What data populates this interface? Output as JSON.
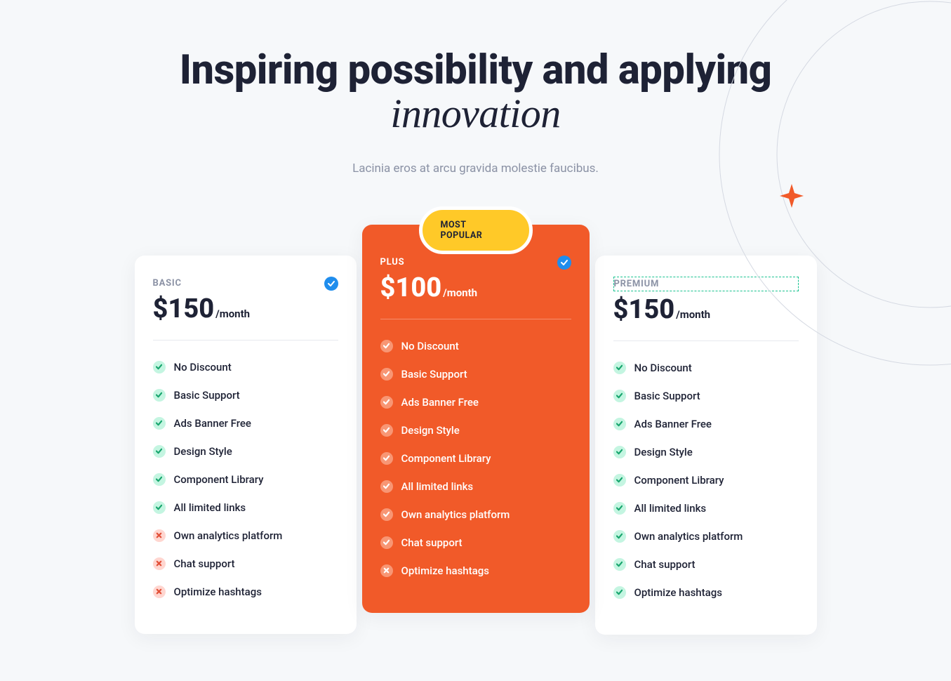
{
  "hero": {
    "title_part1": "Inspiring possibility and applying ",
    "title_em": "innovation",
    "subtitle": "Lacinia eros at arcu gravida molestie faucibus."
  },
  "badge_label": "MOST POPULAR",
  "plans": [
    {
      "name": "BASIC",
      "price": "$150",
      "period": "/month",
      "featured": false,
      "features": [
        {
          "label": "No Discount",
          "included": true
        },
        {
          "label": "Basic Support",
          "included": true
        },
        {
          "label": "Ads Banner Free",
          "included": true
        },
        {
          "label": "Design Style",
          "included": true
        },
        {
          "label": "Component Library",
          "included": true
        },
        {
          "label": "All limited links",
          "included": true
        },
        {
          "label": "Own analytics platform",
          "included": false
        },
        {
          "label": "Chat support",
          "included": false
        },
        {
          "label": "Optimize hashtags",
          "included": false
        }
      ]
    },
    {
      "name": "PLUS",
      "price": "$100",
      "period": "/month",
      "featured": true,
      "features": [
        {
          "label": "No Discount",
          "included": true
        },
        {
          "label": "Basic Support",
          "included": true
        },
        {
          "label": "Ads Banner Free",
          "included": true
        },
        {
          "label": "Design Style",
          "included": true
        },
        {
          "label": "Component Library",
          "included": true
        },
        {
          "label": "All limited links",
          "included": true
        },
        {
          "label": "Own analytics platform",
          "included": true
        },
        {
          "label": "Chat support",
          "included": true
        },
        {
          "label": "Optimize hashtags",
          "included": false
        }
      ]
    },
    {
      "name": "PREMIUM",
      "price": "$150",
      "period": "/month",
      "featured": false,
      "features": [
        {
          "label": "No Discount",
          "included": true
        },
        {
          "label": "Basic Support",
          "included": true
        },
        {
          "label": "Ads Banner Free",
          "included": true
        },
        {
          "label": "Design Style",
          "included": true
        },
        {
          "label": "Component Library",
          "included": true
        },
        {
          "label": "All limited links",
          "included": true
        },
        {
          "label": "Own analytics platform",
          "included": true
        },
        {
          "label": "Chat support",
          "included": true
        },
        {
          "label": "Optimize hashtags",
          "included": true
        }
      ]
    }
  ]
}
